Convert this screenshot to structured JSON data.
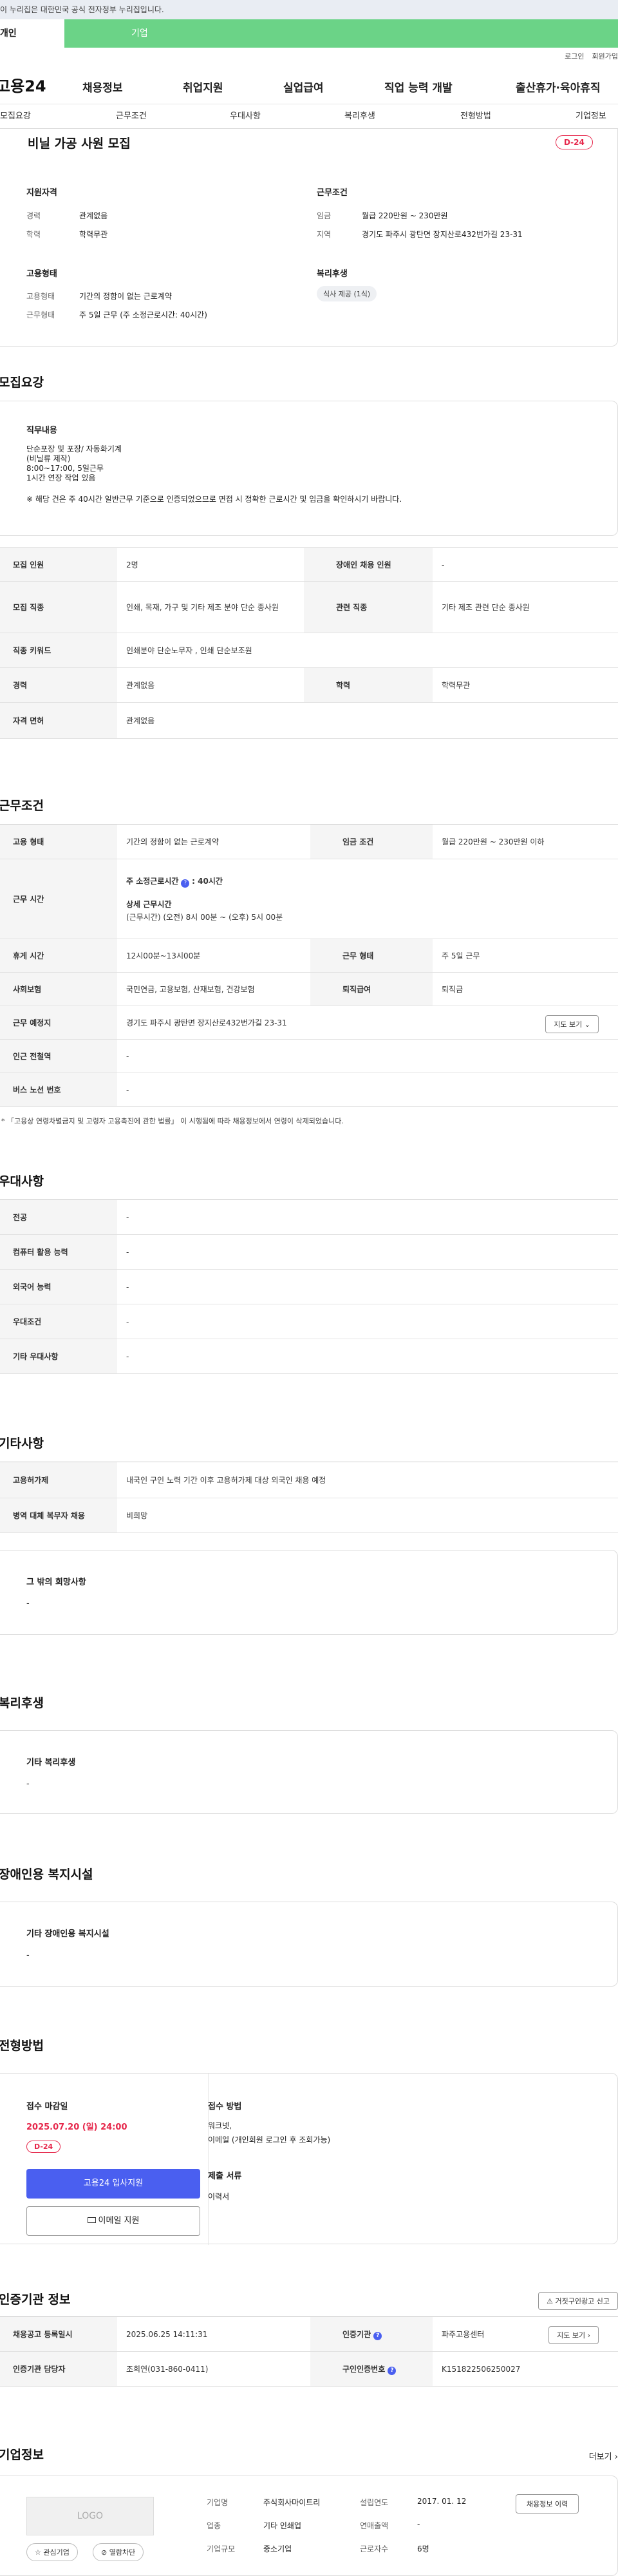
{
  "gov_banner": "이 누리집은 대한민국 공식 전자정부 누리집입니다.",
  "tabs": [
    "개인",
    "기업"
  ],
  "util": [
    "로그인",
    "회원가입"
  ],
  "logo": "고용24",
  "gnb": [
    "채용정보",
    "취업지원",
    "실업급여",
    "직업 능력 개발",
    "출산휴가·육아휴직"
  ],
  "subnav": [
    "모집요강",
    "근무조건",
    "우대사항",
    "복리후생",
    "전형방법",
    "기업정보"
  ],
  "job": {
    "title": "비닐 가공 사원 모집",
    "dday": "D-24",
    "qual_title": "지원자격",
    "cond_title": "근무조건",
    "emp_title": "고용형태",
    "welfare_title": "복리후생",
    "career_l": "경력",
    "career": "관계없음",
    "edu_l": "학력",
    "edu": "학력무관",
    "wage_l": "임금",
    "wage": "월급 220만원 ~ 230만원",
    "loc_l": "지역",
    "loc": "경기도 파주시 광탄면 장지산로432번가길 23-31",
    "emptype_l": "고용형태",
    "emptype": "기간의 정함이 없는 근로계약",
    "worktype_l": "근무형태",
    "worktype": "주 5일 근무 (주 소정근로시간: 40시간)",
    "welfare_badge": "식사 제공 (1식)"
  },
  "recruit": {
    "title": "모집요강",
    "duty_title": "직무내용",
    "duty_lines": [
      "단순포장 및 포장/ 자동화기계",
      "(비닐류 제작)",
      "8:00~17:00, 5일근무",
      "1시간 연장 작업 있음"
    ],
    "duty_note": "※ 해당 건은 주 40시간 일반근무 기준으로 인증되었으므로 면접 시 정확한 근로시간 및 임금을 확인하시기 바랍니다.",
    "rows": [
      {
        "k1": "모집 인원",
        "v1": "2명",
        "k2": "장애인 채용 인원",
        "v2": "-"
      },
      {
        "k1": "모집 직종",
        "v1": "인쇄, 목재, 가구 및 기타 제조 분야 단순 종사원",
        "k2": "관련 직종",
        "v2": "기타 제조 관련 단순 종사원"
      },
      {
        "k1": "직종 키워드",
        "v1": "인쇄분야 단순노무자 , 인쇄 단순보조원"
      },
      {
        "k1": "경력",
        "v1": "관계없음",
        "k2": "학력",
        "v2": "학력무관"
      },
      {
        "k1": "자격 면허",
        "v1": "관계없음"
      }
    ]
  },
  "work": {
    "title": "근무조건",
    "emptype_k": "고용 형태",
    "emptype": "기간의 정함이 없는 근로계약",
    "wage_k": "임금 조건",
    "wage": "월급 220만원 ~ 230만원 이하",
    "time_k": "근무 시간",
    "weekly": "주 소정근로시간",
    "weekly_v": ": 40시간",
    "detail_t": "상세 근무시간",
    "detail_v": "(근무시간) (오전) 8시 00분 ~ (오후) 5시 00분",
    "rest_k": "휴게 시간",
    "rest": "12시00분~13시00분",
    "form_k": "근무 형태",
    "form": "주 5일 근무",
    "ins_k": "사회보험",
    "ins": "국민연금, 고용보험, 산재보험, 건강보험",
    "sev_k": "퇴직급여",
    "sev": "퇴직금",
    "place_k": "근무 예정지",
    "place": "경기도 파주시 광탄면 장지산로432번가길 23-31",
    "map_btn": "지도 보기",
    "subway_k": "인근 전철역",
    "subway": "-",
    "bus_k": "버스 노선 번호",
    "bus": "-",
    "note": "* 「고용상 연령차별금지 및 고령자 고용촉진에 관한 법률」 이 시행됨에 따라 채용정보에서 연령이 삭제되었습니다."
  },
  "pref": {
    "title": "우대사항",
    "rows": [
      {
        "k": "전공",
        "v": "-"
      },
      {
        "k": "컴퓨터 활용 능력",
        "v": "-"
      },
      {
        "k": "외국어 능력",
        "v": "-"
      },
      {
        "k": "우대조건",
        "v": "-"
      },
      {
        "k": "기타 우대사항",
        "v": "-"
      }
    ]
  },
  "etc": {
    "title": "기타사항",
    "rows": [
      {
        "k": "고용허가제",
        "v": "내국인 구인 노력 기간 이후 고용허가제 대상 외국인 채용 예정"
      },
      {
        "k": "병역 대체 복무자 채용",
        "v": "비희망"
      }
    ],
    "other_t": "그 밖의 희망사항",
    "other_v": "-"
  },
  "welfare": {
    "title": "복리후생",
    "box_t": "기타 복리후생",
    "box_v": "-"
  },
  "disabled": {
    "title": "장애인용 복지시설",
    "box_t": "기타 장애인용 복지시설",
    "box_v": "-"
  },
  "screen": {
    "title": "전형방법",
    "deadline_t": "접수 마감일",
    "deadline": "2025.07.20 (일) 24:00",
    "dday": "D-24",
    "apply_btn": "고용24 입사지원",
    "email_btn": "이메일 지원",
    "method_t": "접수 방법",
    "method_lines": [
      "워크넷,",
      "이메일 (개인회원 로그인 후 조회가능)"
    ],
    "docs_t": "제출 서류",
    "docs": "이력서"
  },
  "agency": {
    "title": "인증기관 정보",
    "report_btn": "거짓구인광고 신고",
    "reg_k": "채용공고 등록일시",
    "reg": "2025.06.25 14:11:31",
    "org_k": "인증기관",
    "org": "파주고용센터",
    "map_btn": "지도 보기",
    "staff_k": "인증기관 담당자",
    "staff": "조희연(031-860-0411)",
    "no_k": "구인인증번호",
    "no": "K151822506250027"
  },
  "company": {
    "title": "기업정보",
    "more": "더보기",
    "logo": "LOGO",
    "fav_btn": "관심기업",
    "block_btn": "열람차단",
    "name_k": "기업명",
    "name": "주식회사마이트리",
    "found_k": "설립연도",
    "found": "2017. 01. 12",
    "ind_k": "업종",
    "ind": "기타 인쇄업",
    "sales_k": "연매출액",
    "sales": "-",
    "size_k": "기업규모",
    "size": "중소기업",
    "emp_k": "근로자수",
    "emp": "6명",
    "history_btn": "채용정보 이력"
  },
  "colors": {
    "green": "#6bd387",
    "red": "#e6274b",
    "blue": "#4a5ff0"
  }
}
